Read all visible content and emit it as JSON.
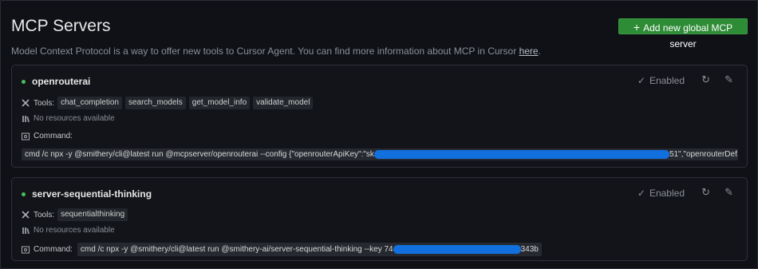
{
  "page": {
    "title": "MCP Servers",
    "add_button": "Add new global MCP server",
    "description": "Model Context Protocol is a way to offer new tools to Cursor Agent. You can find more information about MCP in Cursor ",
    "description_link": "here",
    "description_end": "."
  },
  "labels": {
    "tools": "Tools:",
    "no_resources": "No resources available",
    "command": "Command:",
    "enabled": "Enabled"
  },
  "servers": [
    {
      "name": "openrouterai",
      "status": "Enabled",
      "tools": [
        "chat_completion",
        "search_models",
        "get_model_info",
        "validate_model"
      ],
      "command_prefix": "cmd /c npx -y @smithery/cli@latest run @mcpserver/openrouterai --config {\"openrouterApiKey\":\"sk",
      "command_suffix": "51\",\"openrouterDef..."
    },
    {
      "name": "server-sequential-thinking",
      "status": "Enabled",
      "tools": [
        "sequentialthinking"
      ],
      "command_prefix": "cmd /c npx -y @smithery/cli@latest run @smithery-ai/server-sequential-thinking --key 74",
      "command_suffix": "343b"
    }
  ],
  "colors": {
    "background": "#0f1117",
    "accent_button": "#2e8b36",
    "status_dot": "#4bbd5a",
    "redaction": "#1270de"
  },
  "icons": [
    "plus-icon",
    "check-icon",
    "refresh-icon",
    "pencil-icon",
    "tools-icon",
    "resources-icon",
    "terminal-icon"
  ]
}
